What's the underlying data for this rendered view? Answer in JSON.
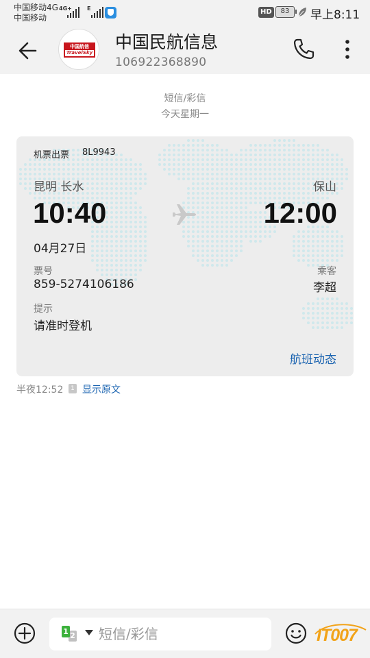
{
  "status_bar": {
    "carrier_1": "中国移动4G",
    "carrier_2": "中国移动",
    "net_tag_1": "4G+",
    "net_tag_2": "E",
    "hd": "HD",
    "battery": "83",
    "time": "早上8:11"
  },
  "header": {
    "contact_name": "中国民航信息",
    "contact_number": "106922368890",
    "logo_top": "中国航信",
    "logo_bottom": "TravelSky"
  },
  "thread": {
    "message_type": "短信/彩信",
    "date": "今天星期一",
    "time": "半夜12:52",
    "sim_tag": "1",
    "show_original": "显示原文"
  },
  "card": {
    "label": "机票出票",
    "flight_no": "8L9943",
    "departure_city": "昆明 长水",
    "arrival_city": "保山",
    "departure_time": "10:40",
    "arrival_time": "12:00",
    "date": "04月27日",
    "ticket_label": "票号",
    "ticket_no": "859-5274106186",
    "passenger_label": "乘客",
    "passenger": "李超",
    "tip_label": "提示",
    "tip": "请准时登机",
    "status_link": "航班动态"
  },
  "compose": {
    "placeholder": "短信/彩信",
    "sim_1": "1",
    "sim_2": "2",
    "watermark": "IT007"
  },
  "icons": {
    "back": "arrow-left",
    "call": "phone",
    "more": "vertical-ellipsis",
    "add": "plus-circle",
    "emoji": "smiley",
    "plane": "airplane"
  },
  "colors": {
    "link": "#1a63b0",
    "card_bg": "#ededed",
    "map_dots": "#cfe8ec",
    "brand_red": "#c8161d"
  }
}
